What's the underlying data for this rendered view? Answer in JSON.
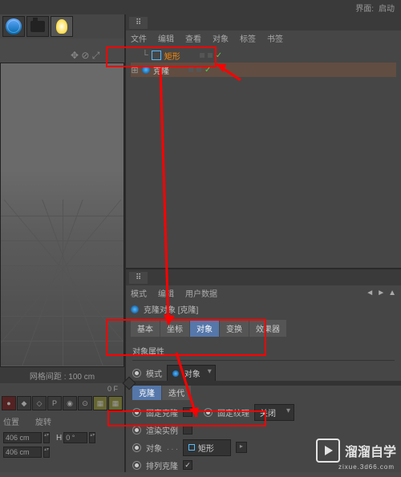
{
  "topbar": {
    "layout_label": "界面:",
    "layout_value": "启动"
  },
  "viewport": {
    "footer": "网格间距 : 100 cm",
    "move_icons": "✥ ⊘ ⤢"
  },
  "objmgr": {
    "menus": [
      "文件",
      "编辑",
      "查看",
      "对象",
      "标签",
      "书签"
    ],
    "row1": {
      "name": "矩形"
    },
    "row2": {
      "name": "克隆"
    }
  },
  "temp": {
    "label": "0 F"
  },
  "bottom": {
    "pos_label": "位置",
    "rot_label": "旋转",
    "x": "406 cm",
    "h": "0 °",
    "y": "406 cm"
  },
  "attr": {
    "menus": [
      "模式",
      "编辑",
      "用户数据"
    ],
    "title": "克隆对象 [克隆]",
    "tabs": [
      "基本",
      "坐标",
      "对象",
      "变换",
      "效果器"
    ],
    "section1": "对象属性",
    "mode_label": "模式",
    "mode_value": "对象",
    "sub_tabs": [
      "克隆",
      "迭代"
    ],
    "fixclone": "固定克隆",
    "fixtex": "固定纹理",
    "fixtex_val": "关闭",
    "render_inst": "渲染实例",
    "object_label": "对象",
    "object_value": "矩形",
    "array_label": "排列克隆"
  },
  "wm": {
    "brand": "溜溜自学",
    "url": "zixue.3d66.com"
  }
}
